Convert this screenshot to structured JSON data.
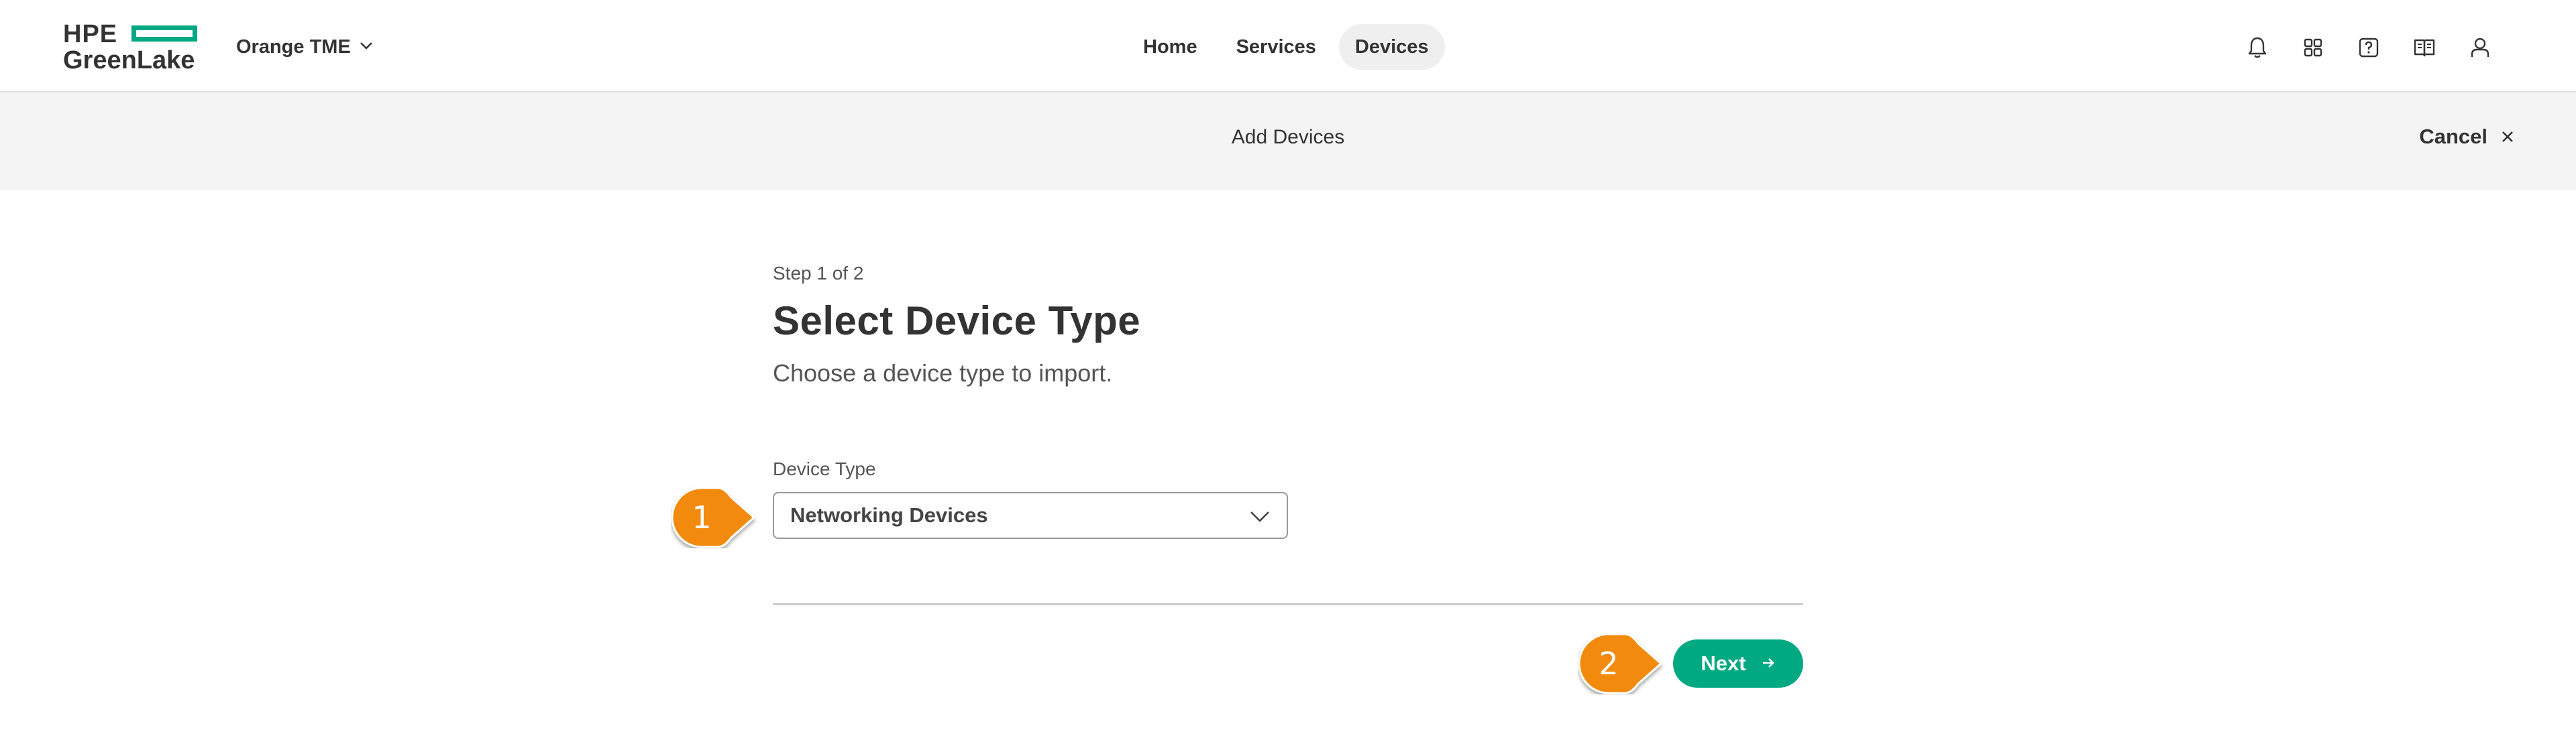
{
  "header": {
    "logo": {
      "line1": "HPE",
      "line2": "GreenLake"
    },
    "workspace": "Orange TME",
    "nav": [
      {
        "label": "Home",
        "active": false
      },
      {
        "label": "Services",
        "active": false
      },
      {
        "label": "Devices",
        "active": true
      }
    ],
    "icons": [
      "bell-icon",
      "apps-grid-icon",
      "help-icon",
      "book-icon",
      "user-icon"
    ]
  },
  "subheader": {
    "title": "Add Devices",
    "cancel_label": "Cancel"
  },
  "wizard": {
    "step": "Step 1 of 2",
    "title": "Select Device Type",
    "subtitle": "Choose a device type to import.",
    "device_type_label": "Device Type",
    "device_type_value": "Networking Devices",
    "next_label": "Next"
  },
  "callouts": [
    "1",
    "2"
  ],
  "colors": {
    "brand_green": "#01a982",
    "callout_orange": "#f28a0c",
    "subheader_bg": "#f4f4f4"
  }
}
